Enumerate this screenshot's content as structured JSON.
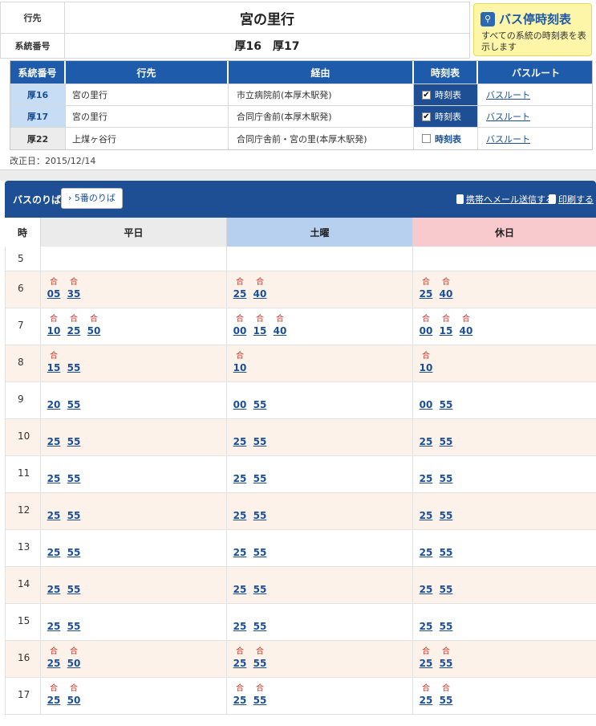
{
  "header": {
    "dest_label": "行先",
    "dest_value": "宮の里行",
    "route_label": "系統番号",
    "route_value": "厚16　厚17"
  },
  "stop_timetable_button": {
    "icon": "bus-stop-pin-icon",
    "title": "バス停時刻表",
    "subtitle": "すべての系統の時刻表を表示します"
  },
  "routes": {
    "headers": [
      "系統番号",
      "行先",
      "経由",
      "時刻表",
      "バスルート"
    ],
    "rows": [
      {
        "no": "厚16",
        "dest": "宮の里行",
        "via": "市立病院前(本厚木駅発)",
        "tt": "時刻表",
        "checked": true,
        "route": "バスルート"
      },
      {
        "no": "厚17",
        "dest": "宮の里行",
        "via": "合同庁舎前(本厚木駅発)",
        "tt": "時刻表",
        "checked": true,
        "route": "バスルート"
      },
      {
        "no": "厚22",
        "dest": "上煤ヶ谷行",
        "via": "合同庁舎前・宮の里(本厚木駅発)",
        "tt": "時刻表",
        "checked": false,
        "route": "バスルート"
      }
    ]
  },
  "revised": "改正日：2015/12/14",
  "timetable_bar": {
    "label": "バスのりば",
    "platform": "5番のりば",
    "mail": "携帯へメール送信する",
    "print": "印刷する"
  },
  "timetable": {
    "headers": {
      "hour": "時",
      "weekday": "平日",
      "saturday": "土曜",
      "holiday": "休日"
    },
    "mark": "合",
    "rows": [
      {
        "hour": "5",
        "weekday": [],
        "saturday": [],
        "holiday": []
      },
      {
        "hour": "6",
        "weekday": [
          {
            "t": "05",
            "m": true
          },
          {
            "t": "35",
            "m": true
          }
        ],
        "saturday": [
          {
            "t": "25",
            "m": true
          },
          {
            "t": "40",
            "m": true
          }
        ],
        "holiday": [
          {
            "t": "25",
            "m": true
          },
          {
            "t": "40",
            "m": true
          }
        ]
      },
      {
        "hour": "7",
        "weekday": [
          {
            "t": "10",
            "m": true
          },
          {
            "t": "25",
            "m": true
          },
          {
            "t": "50",
            "m": true
          }
        ],
        "saturday": [
          {
            "t": "00",
            "m": true
          },
          {
            "t": "15",
            "m": true
          },
          {
            "t": "40",
            "m": true
          }
        ],
        "holiday": [
          {
            "t": "00",
            "m": true
          },
          {
            "t": "15",
            "m": true
          },
          {
            "t": "40",
            "m": true
          }
        ]
      },
      {
        "hour": "8",
        "weekday": [
          {
            "t": "15",
            "m": true
          },
          {
            "t": "55",
            "m": false
          }
        ],
        "saturday": [
          {
            "t": "10",
            "m": true
          }
        ],
        "holiday": [
          {
            "t": "10",
            "m": true
          }
        ]
      },
      {
        "hour": "9",
        "weekday": [
          {
            "t": "20",
            "m": false
          },
          {
            "t": "55",
            "m": false
          }
        ],
        "saturday": [
          {
            "t": "00",
            "m": false
          },
          {
            "t": "55",
            "m": false
          }
        ],
        "holiday": [
          {
            "t": "00",
            "m": false
          },
          {
            "t": "55",
            "m": false
          }
        ]
      },
      {
        "hour": "10",
        "weekday": [
          {
            "t": "25",
            "m": false
          },
          {
            "t": "55",
            "m": false
          }
        ],
        "saturday": [
          {
            "t": "25",
            "m": false
          },
          {
            "t": "55",
            "m": false
          }
        ],
        "holiday": [
          {
            "t": "25",
            "m": false
          },
          {
            "t": "55",
            "m": false
          }
        ]
      },
      {
        "hour": "11",
        "weekday": [
          {
            "t": "25",
            "m": false
          },
          {
            "t": "55",
            "m": false
          }
        ],
        "saturday": [
          {
            "t": "25",
            "m": false
          },
          {
            "t": "55",
            "m": false
          }
        ],
        "holiday": [
          {
            "t": "25",
            "m": false
          },
          {
            "t": "55",
            "m": false
          }
        ]
      },
      {
        "hour": "12",
        "weekday": [
          {
            "t": "25",
            "m": false
          },
          {
            "t": "55",
            "m": false
          }
        ],
        "saturday": [
          {
            "t": "25",
            "m": false
          },
          {
            "t": "55",
            "m": false
          }
        ],
        "holiday": [
          {
            "t": "25",
            "m": false
          },
          {
            "t": "55",
            "m": false
          }
        ]
      },
      {
        "hour": "13",
        "weekday": [
          {
            "t": "25",
            "m": false
          },
          {
            "t": "55",
            "m": false
          }
        ],
        "saturday": [
          {
            "t": "25",
            "m": false
          },
          {
            "t": "55",
            "m": false
          }
        ],
        "holiday": [
          {
            "t": "25",
            "m": false
          },
          {
            "t": "55",
            "m": false
          }
        ]
      },
      {
        "hour": "14",
        "weekday": [
          {
            "t": "25",
            "m": false
          },
          {
            "t": "55",
            "m": false
          }
        ],
        "saturday": [
          {
            "t": "25",
            "m": false
          },
          {
            "t": "55",
            "m": false
          }
        ],
        "holiday": [
          {
            "t": "25",
            "m": false
          },
          {
            "t": "55",
            "m": false
          }
        ]
      },
      {
        "hour": "15",
        "weekday": [
          {
            "t": "25",
            "m": false
          },
          {
            "t": "55",
            "m": false
          }
        ],
        "saturday": [
          {
            "t": "25",
            "m": false
          },
          {
            "t": "55",
            "m": false
          }
        ],
        "holiday": [
          {
            "t": "25",
            "m": false
          },
          {
            "t": "55",
            "m": false
          }
        ]
      },
      {
        "hour": "16",
        "weekday": [
          {
            "t": "25",
            "m": true
          },
          {
            "t": "50",
            "m": true
          }
        ],
        "saturday": [
          {
            "t": "25",
            "m": true
          },
          {
            "t": "55",
            "m": true
          }
        ],
        "holiday": [
          {
            "t": "25",
            "m": true
          },
          {
            "t": "55",
            "m": true
          }
        ]
      },
      {
        "hour": "17",
        "weekday": [
          {
            "t": "25",
            "m": true
          },
          {
            "t": "50",
            "m": true
          }
        ],
        "saturday": [
          {
            "t": "25",
            "m": true
          },
          {
            "t": "55",
            "m": true
          }
        ],
        "holiday": [
          {
            "t": "25",
            "m": true
          },
          {
            "t": "55",
            "m": true
          }
        ]
      }
    ]
  }
}
